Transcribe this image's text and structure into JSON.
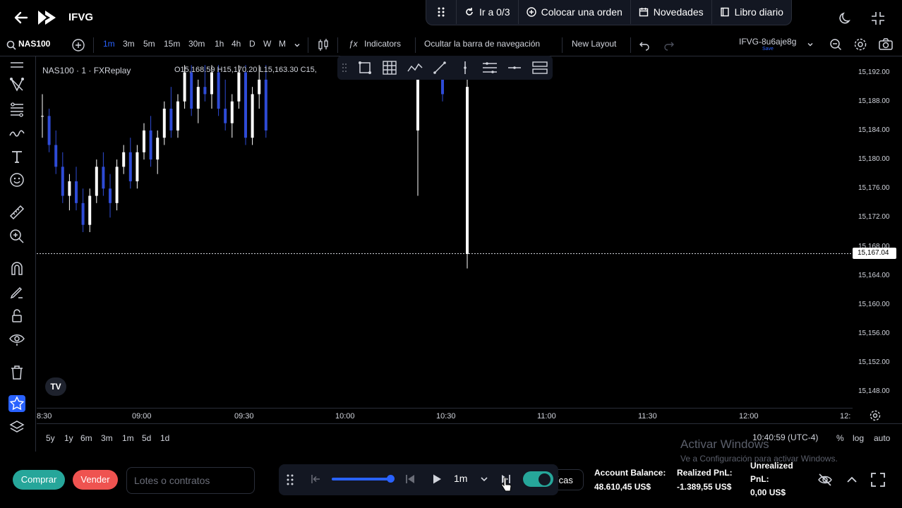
{
  "app": {
    "name": "IFVG"
  },
  "top_actions": [
    {
      "label": "Ir a 0/3",
      "icon": "rewind-icon"
    },
    {
      "label": "Colocar una orden",
      "icon": "plus-circle-icon"
    },
    {
      "label": "Novedades",
      "icon": "calendar-icon"
    },
    {
      "label": "Libro diario",
      "icon": "book-icon"
    }
  ],
  "toolbar": {
    "symbol": "NAS100",
    "timeframes": [
      "1m",
      "3m",
      "5m",
      "15m",
      "30m",
      "1h",
      "4h",
      "D",
      "W",
      "M"
    ],
    "active_timeframe": "1m",
    "indicators_label": "Indicators",
    "hide_nav_label": "Ocultar la barra de navegación",
    "new_layout_label": "New Layout",
    "layout_name": "IFVG-8u6aje8g",
    "layout_status": "Save"
  },
  "chart": {
    "legend": "NAS100 · 1 · FXReplay",
    "ohlc": "O15,168.59 H15,170.20 L15,163.30 C15,",
    "current_price": "15,167.04",
    "logo": "TV"
  },
  "chart_data": {
    "type": "candlestick",
    "symbol": "NAS100",
    "interval": "1",
    "y_ticks": [
      "15,192.00",
      "15,188.00",
      "15,184.00",
      "15,180.00",
      "15,176.00",
      "15,172.00",
      "15,168.00",
      "15,164.00",
      "15,160.00",
      "15,156.00",
      "15,152.00",
      "15,148.00"
    ],
    "ylim": [
      15146,
      15194
    ],
    "x_ticks": [
      "8:30",
      "09:00",
      "09:30",
      "10:00",
      "10:30",
      "11:00",
      "11:30",
      "12:00",
      "12:"
    ],
    "last_price": 15167.04,
    "candles": [
      [
        15186,
        15189,
        15183,
        15186
      ],
      [
        15186,
        15187,
        15181,
        15182
      ],
      [
        15182,
        15184,
        15178,
        15179
      ],
      [
        15179,
        15181,
        15174,
        15175
      ],
      [
        15175,
        15178,
        15173,
        15177
      ],
      [
        15177,
        15179,
        15173,
        15174
      ],
      [
        15174,
        15176,
        15170,
        15171
      ],
      [
        15171,
        15176,
        15170,
        15175
      ],
      [
        15175,
        15180,
        15174,
        15179
      ],
      [
        15179,
        15181,
        15175,
        15176
      ],
      [
        15176,
        15178,
        15172,
        15174
      ],
      [
        15174,
        15180,
        15173,
        15179
      ],
      [
        15179,
        15182,
        15178,
        15181
      ],
      [
        15181,
        15183,
        15176,
        15177
      ],
      [
        15177,
        15182,
        15176,
        15181
      ],
      [
        15181,
        15185,
        15180,
        15184
      ],
      [
        15184,
        15186,
        15179,
        15180
      ],
      [
        15180,
        15184,
        15178,
        15183
      ],
      [
        15183,
        15188,
        15182,
        15187
      ],
      [
        15187,
        15190,
        15183,
        15184
      ],
      [
        15184,
        15189,
        15183,
        15188
      ],
      [
        15188,
        15193,
        15187,
        15192
      ],
      [
        15192,
        15193,
        15186,
        15187
      ],
      [
        15187,
        15191,
        15185,
        15190
      ],
      [
        15190,
        15193,
        15188,
        15189
      ],
      [
        15189,
        15193,
        15187,
        15192
      ],
      [
        15192,
        15193,
        15186,
        15187
      ],
      [
        15187,
        15191,
        15184,
        15185
      ],
      [
        15185,
        15189,
        15183,
        15188
      ],
      [
        15188,
        15193,
        15187,
        15192
      ],
      [
        15192,
        15193,
        15182,
        15183
      ],
      [
        15183,
        15190,
        15182,
        15189
      ],
      [
        15189,
        15193,
        15187,
        15191
      ],
      [
        15191,
        15193,
        15183,
        15184
      ],
      [
        15184,
        15193,
        15175,
        15192
      ],
      [
        15192,
        15193,
        15188,
        15189
      ],
      [
        15167,
        15193,
        15165,
        15190
      ]
    ]
  },
  "ranges": [
    "5y",
    "1y",
    "6m",
    "3m",
    "1m",
    "5d",
    "1d"
  ],
  "clock": "10:40:59 (UTC-4)",
  "scale_options": [
    "%",
    "log",
    "auto"
  ],
  "watermark": {
    "title": "Activar Windows",
    "subtitle": "Ve a Configuración para activar Windows."
  },
  "trading": {
    "buy_label": "Comprar",
    "sell_label": "Vender",
    "lots_placeholder": "Lotes o contratos",
    "speed": "1m",
    "metrics_label": "ícas"
  },
  "stats": {
    "balance_label": "Account Balance:",
    "balance_value": "48.610,45 US$",
    "realized_label": "Realized PnL:",
    "realized_value": "-1.389,55 US$",
    "unrealized_label_1": "Unrealized",
    "unrealized_label_2": "PnL:",
    "unrealized_value": "0,00 US$"
  }
}
